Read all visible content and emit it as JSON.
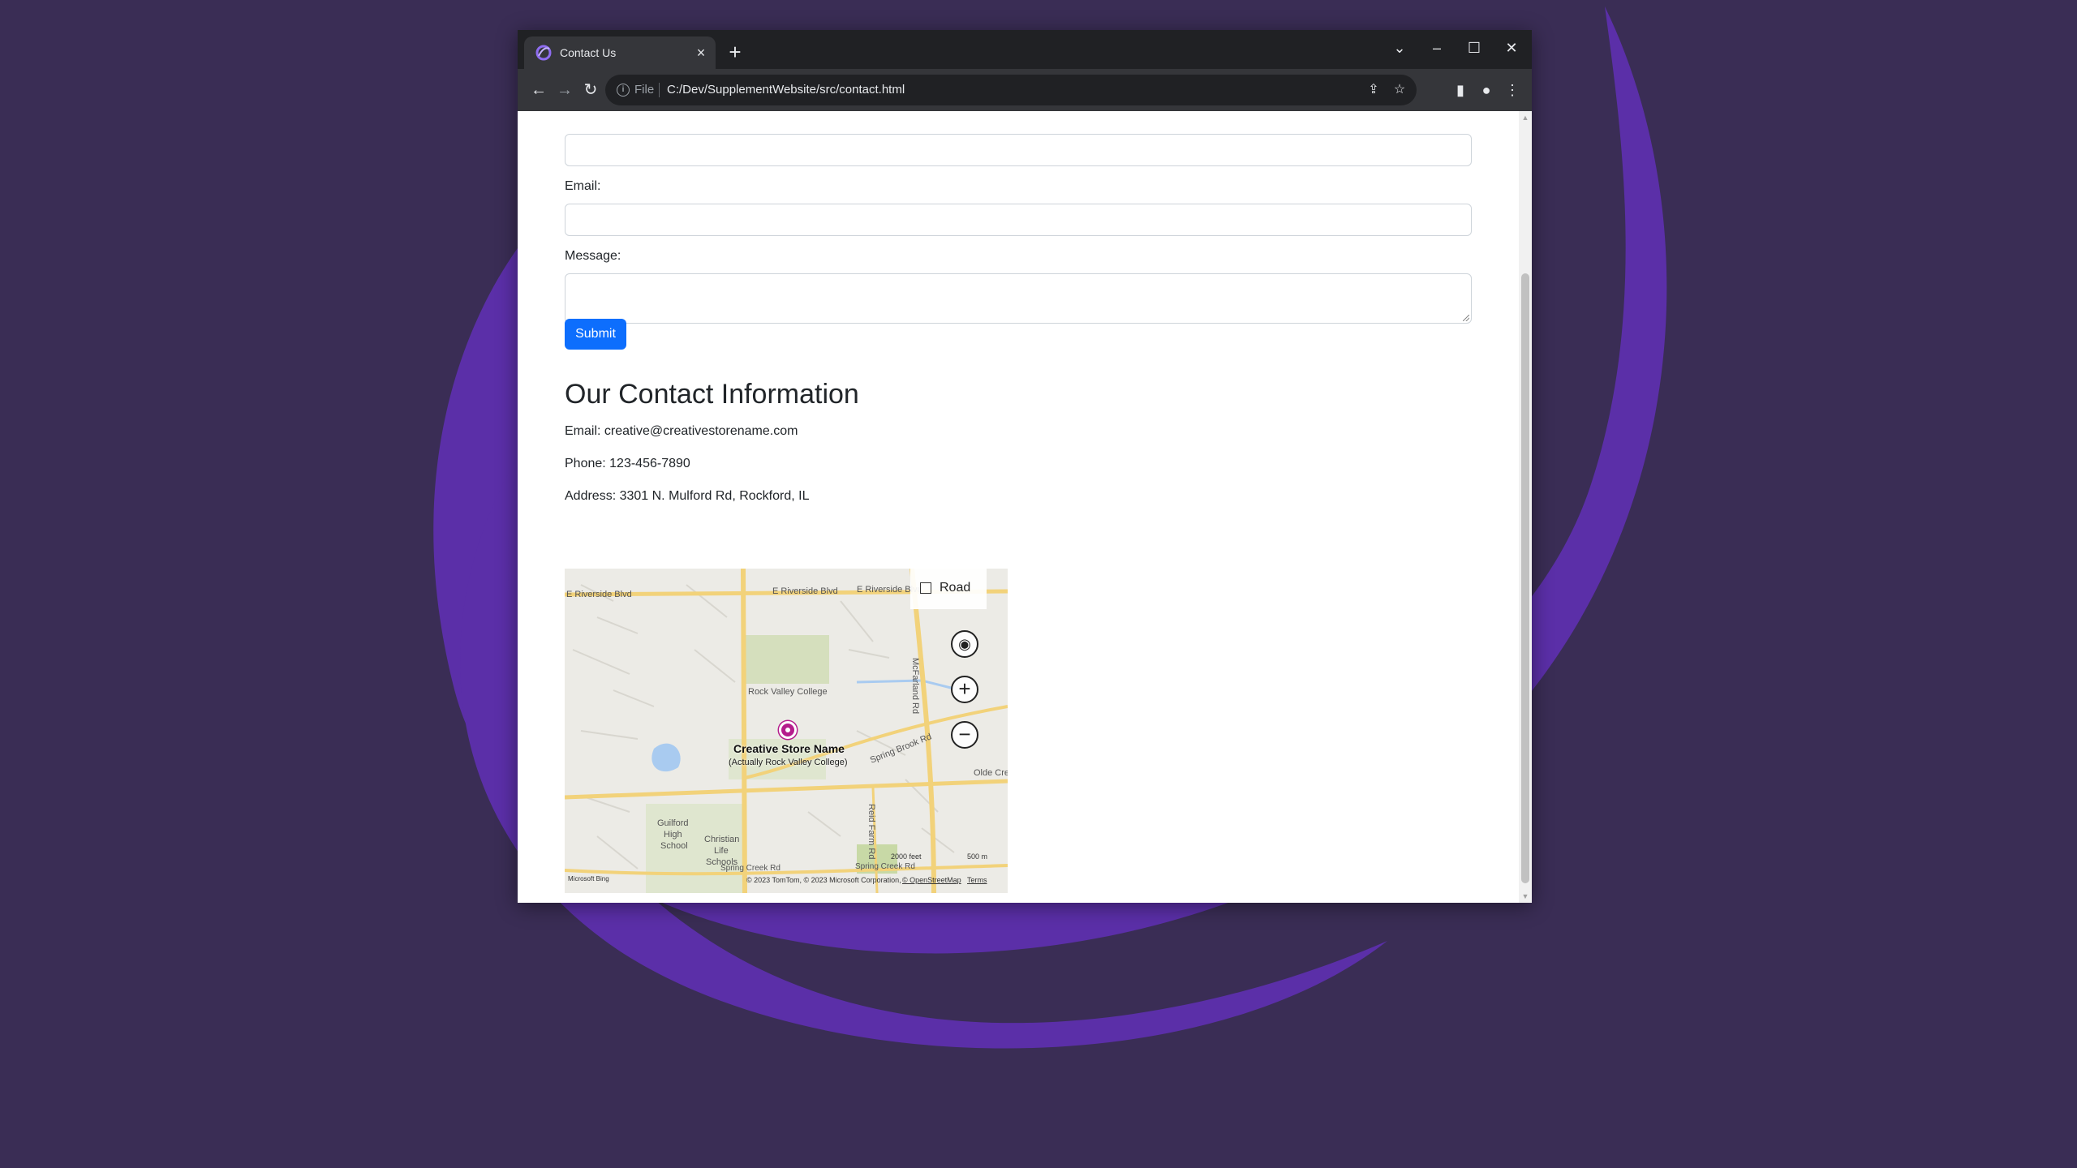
{
  "browser": {
    "tab_title": "Contact Us",
    "tab_close": "×",
    "new_tab": "+",
    "scheme": "File",
    "url": "C:/Dev/SupplementWebsite/src/contact.html"
  },
  "form": {
    "email_label": "Email:",
    "message_label": "Message:",
    "submit_label": "Submit"
  },
  "contact": {
    "heading": "Our Contact Information",
    "email": "Email: creative@creativestorename.com",
    "phone": "Phone: 123-456-7890",
    "address": "Address: 3301 N. Mulford Rd, Rockford, IL"
  },
  "map": {
    "style_label": "Road",
    "pin_title": "Creative Store Name",
    "pin_subtitle": "(Actually Rock Valley College)",
    "labels": {
      "riverside_w": "E Riverside Blvd",
      "riverside_mid": "E Riverside Blvd",
      "riverside_e": "E Riverside Blvd",
      "rock_valley": "Rock Valley College",
      "spring_brook": "Spring Brook Rd",
      "mcfarland": "McFarland Rd",
      "olde_creek": "Olde Creek",
      "guilford_1": "Guilford",
      "guilford_2": "High",
      "guilford_3": "School",
      "christian_1": "Christian",
      "christian_2": "Life",
      "christian_3": "Schools",
      "spring_creek_w": "Spring Creek Rd",
      "spring_creek_e": "Spring Creek Rd",
      "reid_farm": "Reid Farm Rd"
    },
    "scale_feet": "2000 feet",
    "scale_meters": "500 m",
    "logo": "Microsoft Bing",
    "copyright": "© 2023 TomTom, © 2023 Microsoft Corporation,",
    "osm": "© OpenStreetMap",
    "terms": "Terms"
  },
  "colors": {
    "primary_button": "#0d6efd",
    "map_pin": "#b51c8c",
    "wallpaper_bg": "#3a2d55",
    "wallpaper_accent": "#5b2fa8"
  }
}
